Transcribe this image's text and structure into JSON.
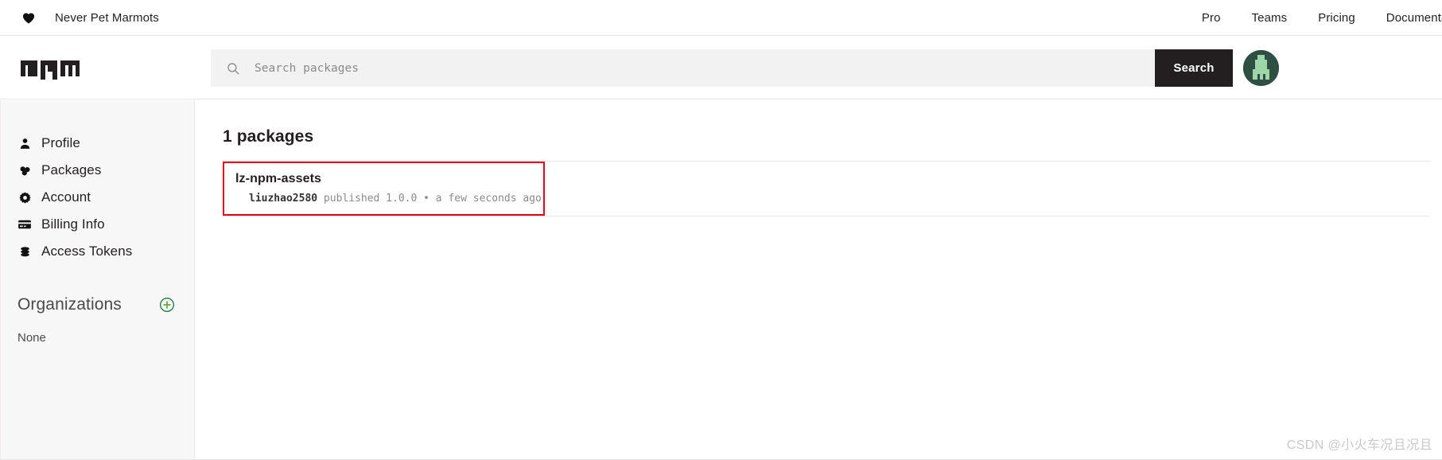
{
  "topbar": {
    "heart_icon": "heart-icon",
    "brand": "Never Pet Marmots",
    "links": [
      {
        "label": "Pro"
      },
      {
        "label": "Teams"
      },
      {
        "label": "Pricing"
      },
      {
        "label": "Documentation"
      }
    ]
  },
  "header": {
    "logo_text": "npm",
    "search": {
      "icon": "search-icon",
      "value": "",
      "placeholder": "Search packages",
      "button_label": "Search"
    },
    "avatar": "user-avatar"
  },
  "sidebar": {
    "items": [
      {
        "label": "Profile",
        "icon": "user-icon"
      },
      {
        "label": "Packages",
        "icon": "packages-icon"
      },
      {
        "label": "Account",
        "icon": "gear-icon"
      },
      {
        "label": "Billing Info",
        "icon": "credit-card-icon"
      },
      {
        "label": "Access Tokens",
        "icon": "tokens-icon"
      }
    ],
    "organizations": {
      "title": "Organizations",
      "add_icon": "plus-circle-icon",
      "empty_label": "None"
    }
  },
  "main": {
    "packages_count_label": "1 packages",
    "packages": [
      {
        "name": "lz-npm-assets",
        "publisher": "liuzhao2580",
        "meta_suffix": " published 1.0.0 • a few seconds ago",
        "highlighted": true
      }
    ]
  },
  "watermark": {
    "text": "CSDN @小火车况且况且"
  },
  "colors": {
    "accent_dark": "#231f20",
    "highlight_red": "#e60012",
    "org_green": "#1f7a3f",
    "sidebar_bg": "#f7f7f7",
    "search_bg": "#f2f2f2"
  }
}
